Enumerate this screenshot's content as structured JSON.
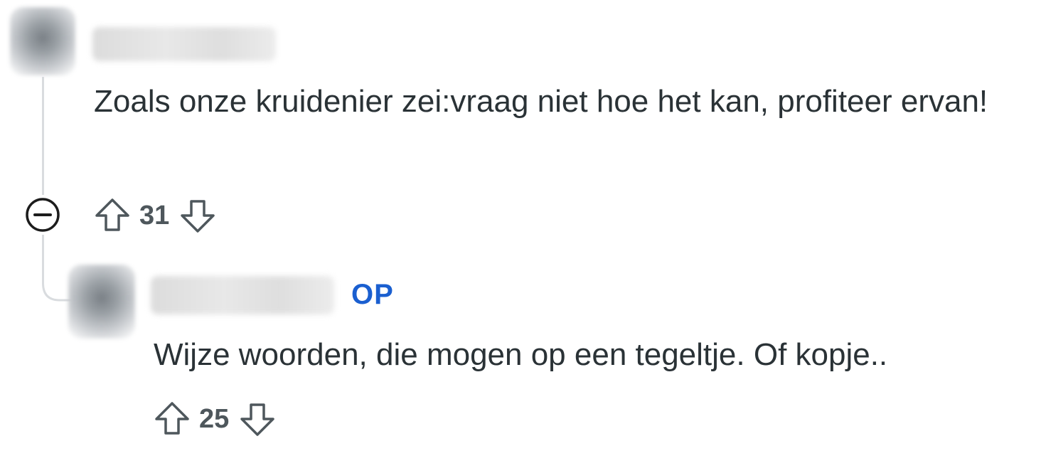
{
  "comments": [
    {
      "author": "",
      "is_op": false,
      "text": "Zoals onze kruidenier zei:vraag niet hoe het kan, profiteer ervan!",
      "score": "31"
    },
    {
      "author": "",
      "is_op": true,
      "op_label": "OP",
      "text": "Wijze woorden, die mogen op een tegeltje. Of kopje..",
      "score": "25"
    }
  ],
  "icons": {
    "upvote": "arrow-up-outline-icon",
    "downvote": "arrow-down-outline-icon",
    "collapse": "minus-circle-icon"
  },
  "colors": {
    "op_badge": "#1a5fd0",
    "text": "#2a3236",
    "thread_line": "#d9dcdf"
  }
}
